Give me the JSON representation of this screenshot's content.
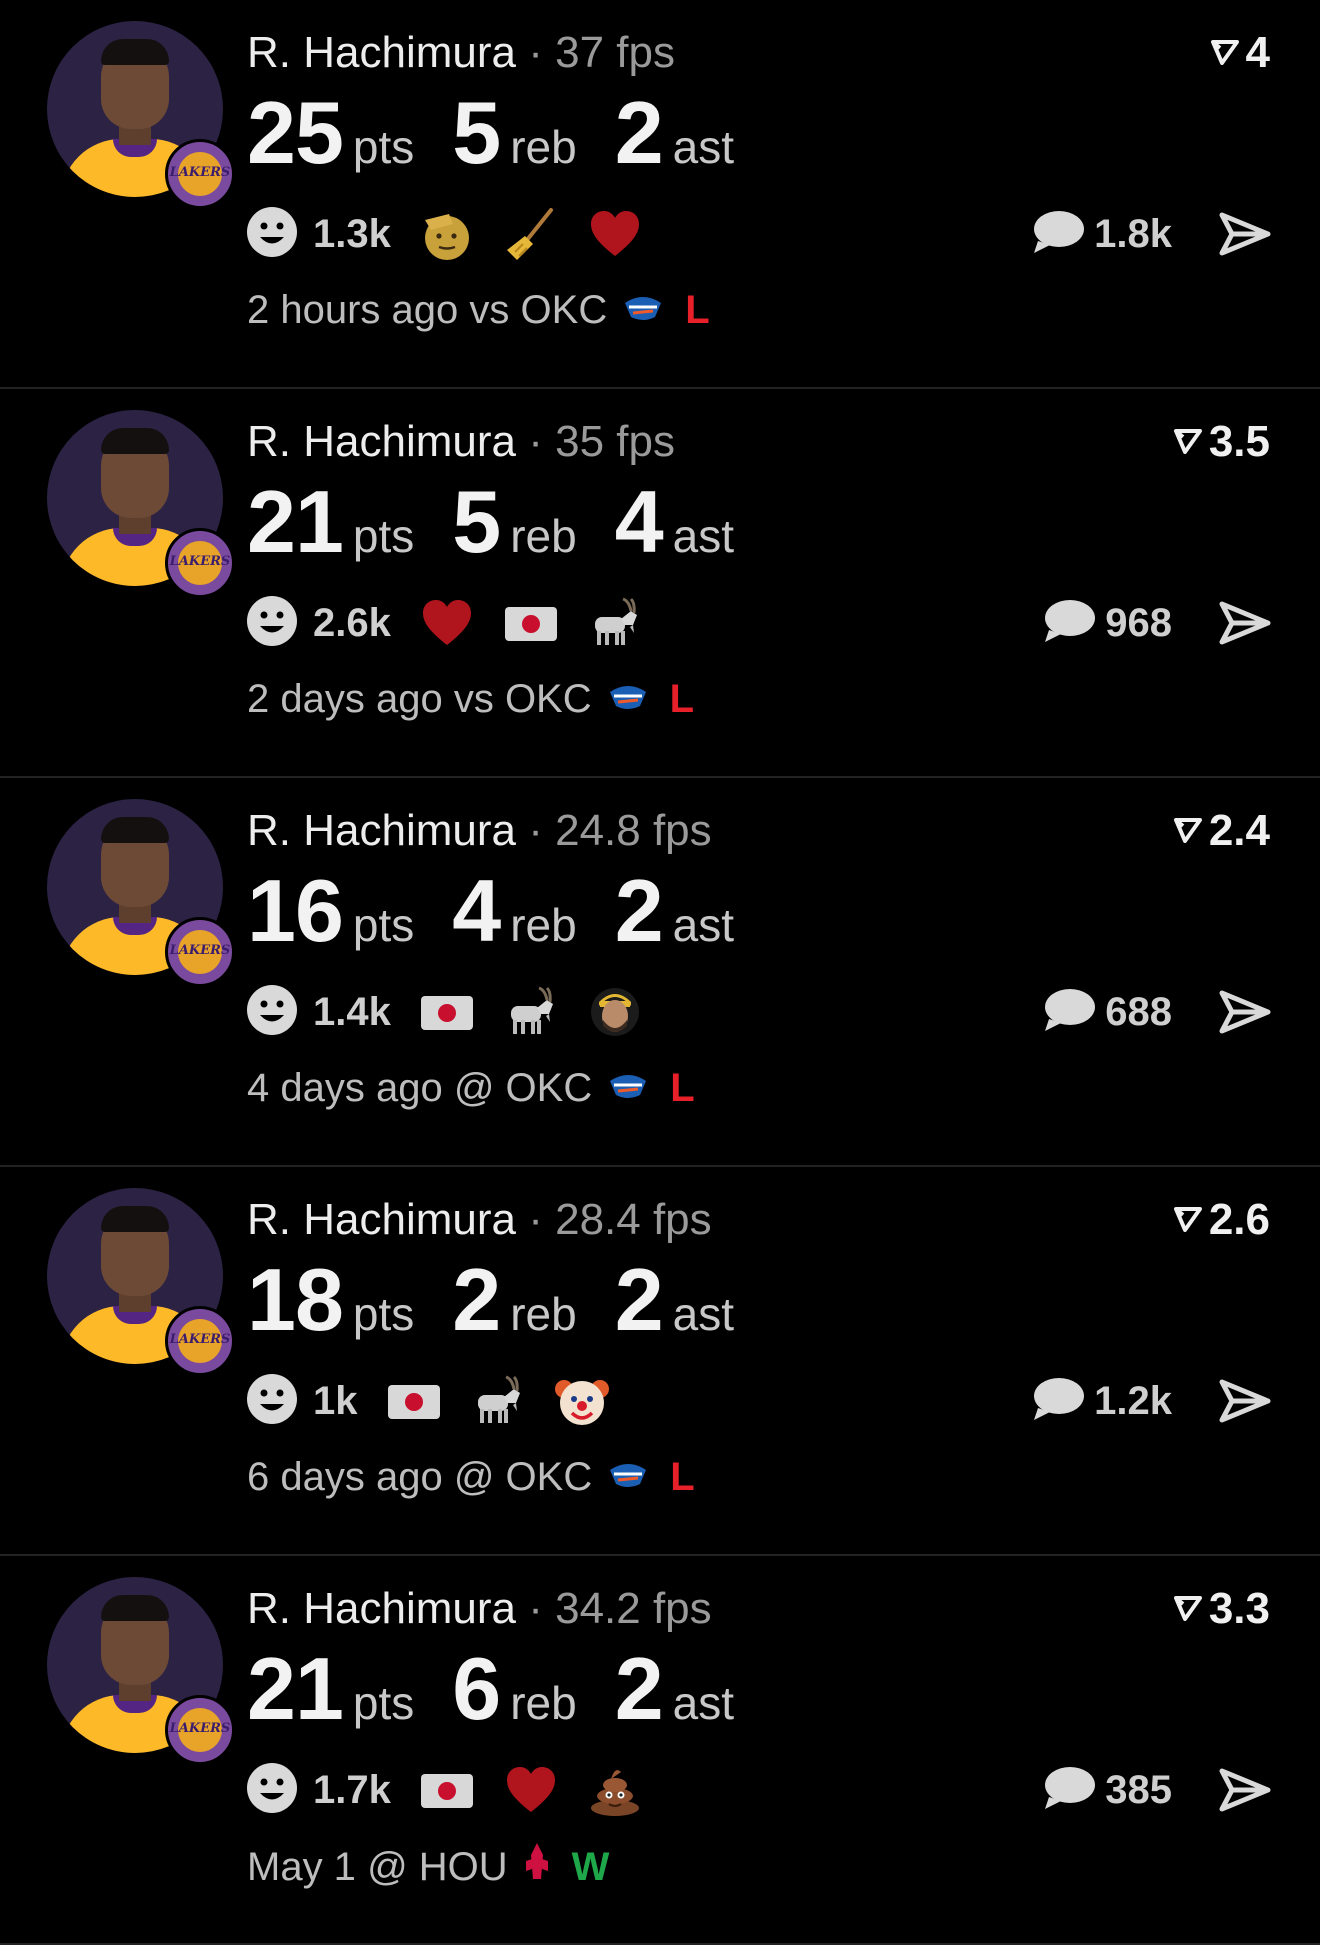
{
  "feed": [
    {
      "player": "R. Hachimura",
      "fps": "37 fps",
      "rating": "4",
      "pts": "25",
      "reb": "5",
      "ast": "2",
      "pts_label": "pts",
      "reb_label": "reb",
      "ast_label": "ast",
      "reactions_count": "1.3k",
      "reactions": [
        "saluting-face",
        "broom",
        "red-heart"
      ],
      "comments": "1.8k",
      "time": "2 hours ago",
      "opp": "vs OKC",
      "opp_team": "okc",
      "result": "L",
      "result_color": "#e8202a"
    },
    {
      "player": "R. Hachimura",
      "fps": "35 fps",
      "rating": "3.5",
      "pts": "21",
      "reb": "5",
      "ast": "4",
      "pts_label": "pts",
      "reb_label": "reb",
      "ast_label": "ast",
      "reactions_count": "2.6k",
      "reactions": [
        "red-heart",
        "japan-flag",
        "goat"
      ],
      "comments": "968",
      "time": "2 days ago",
      "opp": "vs OKC",
      "opp_team": "okc",
      "result": "L",
      "result_color": "#e8202a"
    },
    {
      "player": "R. Hachimura",
      "fps": "24.8 fps",
      "rating": "2.4",
      "pts": "16",
      "reb": "4",
      "ast": "2",
      "pts_label": "pts",
      "reb_label": "reb",
      "ast_label": "ast",
      "reactions_count": "1.4k",
      "reactions": [
        "japan-flag",
        "goat",
        "player-face"
      ],
      "comments": "688",
      "time": "4 days ago",
      "opp": "@ OKC",
      "opp_team": "okc",
      "result": "L",
      "result_color": "#e8202a"
    },
    {
      "player": "R. Hachimura",
      "fps": "28.4 fps",
      "rating": "2.6",
      "pts": "18",
      "reb": "2",
      "ast": "2",
      "pts_label": "pts",
      "reb_label": "reb",
      "ast_label": "ast",
      "reactions_count": "1k",
      "reactions": [
        "japan-flag",
        "goat",
        "clown-face"
      ],
      "comments": "1.2k",
      "time": "6 days ago",
      "opp": "@ OKC",
      "opp_team": "okc",
      "result": "L",
      "result_color": "#e8202a"
    },
    {
      "player": "R. Hachimura",
      "fps": "34.2 fps",
      "rating": "3.3",
      "pts": "21",
      "reb": "6",
      "ast": "2",
      "pts_label": "pts",
      "reb_label": "reb",
      "ast_label": "ast",
      "reactions_count": "1.7k",
      "reactions": [
        "japan-flag",
        "red-heart",
        "pile-of-poo"
      ],
      "comments": "385",
      "time": "May 1",
      "opp": "@ HOU",
      "opp_team": "hou",
      "result": "W",
      "result_color": "#1fa84a"
    }
  ],
  "icons": {
    "team_badge_text": "LAKERS",
    "smiley": "smiley-icon",
    "comment": "comment-bubble-icon",
    "share": "share-arrow-icon",
    "rating": "rating-flag-icon"
  },
  "colors": {
    "background": "#000000",
    "loss": "#e8202a",
    "win": "#1fa84a",
    "lakers_purple": "#552583",
    "lakers_gold": "#fdb927"
  }
}
